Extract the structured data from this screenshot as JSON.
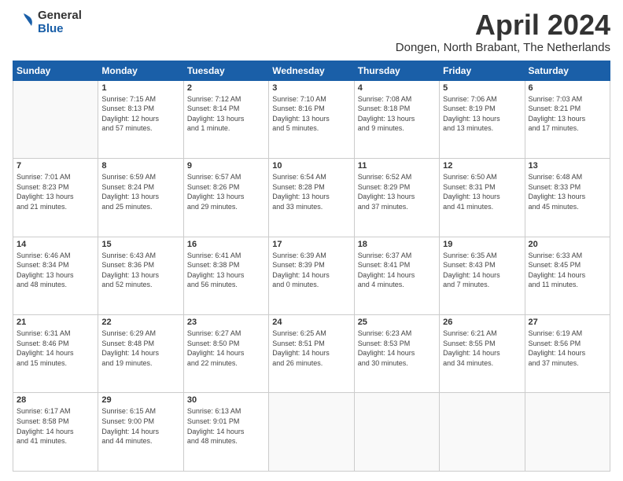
{
  "header": {
    "logo_general": "General",
    "logo_blue": "Blue",
    "month_title": "April 2024",
    "location": "Dongen, North Brabant, The Netherlands"
  },
  "days_of_week": [
    "Sunday",
    "Monday",
    "Tuesday",
    "Wednesday",
    "Thursday",
    "Friday",
    "Saturday"
  ],
  "weeks": [
    [
      {
        "day": "",
        "info": ""
      },
      {
        "day": "1",
        "info": "Sunrise: 7:15 AM\nSunset: 8:13 PM\nDaylight: 12 hours\nand 57 minutes."
      },
      {
        "day": "2",
        "info": "Sunrise: 7:12 AM\nSunset: 8:14 PM\nDaylight: 13 hours\nand 1 minute."
      },
      {
        "day": "3",
        "info": "Sunrise: 7:10 AM\nSunset: 8:16 PM\nDaylight: 13 hours\nand 5 minutes."
      },
      {
        "day": "4",
        "info": "Sunrise: 7:08 AM\nSunset: 8:18 PM\nDaylight: 13 hours\nand 9 minutes."
      },
      {
        "day": "5",
        "info": "Sunrise: 7:06 AM\nSunset: 8:19 PM\nDaylight: 13 hours\nand 13 minutes."
      },
      {
        "day": "6",
        "info": "Sunrise: 7:03 AM\nSunset: 8:21 PM\nDaylight: 13 hours\nand 17 minutes."
      }
    ],
    [
      {
        "day": "7",
        "info": "Sunrise: 7:01 AM\nSunset: 8:23 PM\nDaylight: 13 hours\nand 21 minutes."
      },
      {
        "day": "8",
        "info": "Sunrise: 6:59 AM\nSunset: 8:24 PM\nDaylight: 13 hours\nand 25 minutes."
      },
      {
        "day": "9",
        "info": "Sunrise: 6:57 AM\nSunset: 8:26 PM\nDaylight: 13 hours\nand 29 minutes."
      },
      {
        "day": "10",
        "info": "Sunrise: 6:54 AM\nSunset: 8:28 PM\nDaylight: 13 hours\nand 33 minutes."
      },
      {
        "day": "11",
        "info": "Sunrise: 6:52 AM\nSunset: 8:29 PM\nDaylight: 13 hours\nand 37 minutes."
      },
      {
        "day": "12",
        "info": "Sunrise: 6:50 AM\nSunset: 8:31 PM\nDaylight: 13 hours\nand 41 minutes."
      },
      {
        "day": "13",
        "info": "Sunrise: 6:48 AM\nSunset: 8:33 PM\nDaylight: 13 hours\nand 45 minutes."
      }
    ],
    [
      {
        "day": "14",
        "info": "Sunrise: 6:46 AM\nSunset: 8:34 PM\nDaylight: 13 hours\nand 48 minutes."
      },
      {
        "day": "15",
        "info": "Sunrise: 6:43 AM\nSunset: 8:36 PM\nDaylight: 13 hours\nand 52 minutes."
      },
      {
        "day": "16",
        "info": "Sunrise: 6:41 AM\nSunset: 8:38 PM\nDaylight: 13 hours\nand 56 minutes."
      },
      {
        "day": "17",
        "info": "Sunrise: 6:39 AM\nSunset: 8:39 PM\nDaylight: 14 hours\nand 0 minutes."
      },
      {
        "day": "18",
        "info": "Sunrise: 6:37 AM\nSunset: 8:41 PM\nDaylight: 14 hours\nand 4 minutes."
      },
      {
        "day": "19",
        "info": "Sunrise: 6:35 AM\nSunset: 8:43 PM\nDaylight: 14 hours\nand 7 minutes."
      },
      {
        "day": "20",
        "info": "Sunrise: 6:33 AM\nSunset: 8:45 PM\nDaylight: 14 hours\nand 11 minutes."
      }
    ],
    [
      {
        "day": "21",
        "info": "Sunrise: 6:31 AM\nSunset: 8:46 PM\nDaylight: 14 hours\nand 15 minutes."
      },
      {
        "day": "22",
        "info": "Sunrise: 6:29 AM\nSunset: 8:48 PM\nDaylight: 14 hours\nand 19 minutes."
      },
      {
        "day": "23",
        "info": "Sunrise: 6:27 AM\nSunset: 8:50 PM\nDaylight: 14 hours\nand 22 minutes."
      },
      {
        "day": "24",
        "info": "Sunrise: 6:25 AM\nSunset: 8:51 PM\nDaylight: 14 hours\nand 26 minutes."
      },
      {
        "day": "25",
        "info": "Sunrise: 6:23 AM\nSunset: 8:53 PM\nDaylight: 14 hours\nand 30 minutes."
      },
      {
        "day": "26",
        "info": "Sunrise: 6:21 AM\nSunset: 8:55 PM\nDaylight: 14 hours\nand 34 minutes."
      },
      {
        "day": "27",
        "info": "Sunrise: 6:19 AM\nSunset: 8:56 PM\nDaylight: 14 hours\nand 37 minutes."
      }
    ],
    [
      {
        "day": "28",
        "info": "Sunrise: 6:17 AM\nSunset: 8:58 PM\nDaylight: 14 hours\nand 41 minutes."
      },
      {
        "day": "29",
        "info": "Sunrise: 6:15 AM\nSunset: 9:00 PM\nDaylight: 14 hours\nand 44 minutes."
      },
      {
        "day": "30",
        "info": "Sunrise: 6:13 AM\nSunset: 9:01 PM\nDaylight: 14 hours\nand 48 minutes."
      },
      {
        "day": "",
        "info": ""
      },
      {
        "day": "",
        "info": ""
      },
      {
        "day": "",
        "info": ""
      },
      {
        "day": "",
        "info": ""
      }
    ]
  ]
}
